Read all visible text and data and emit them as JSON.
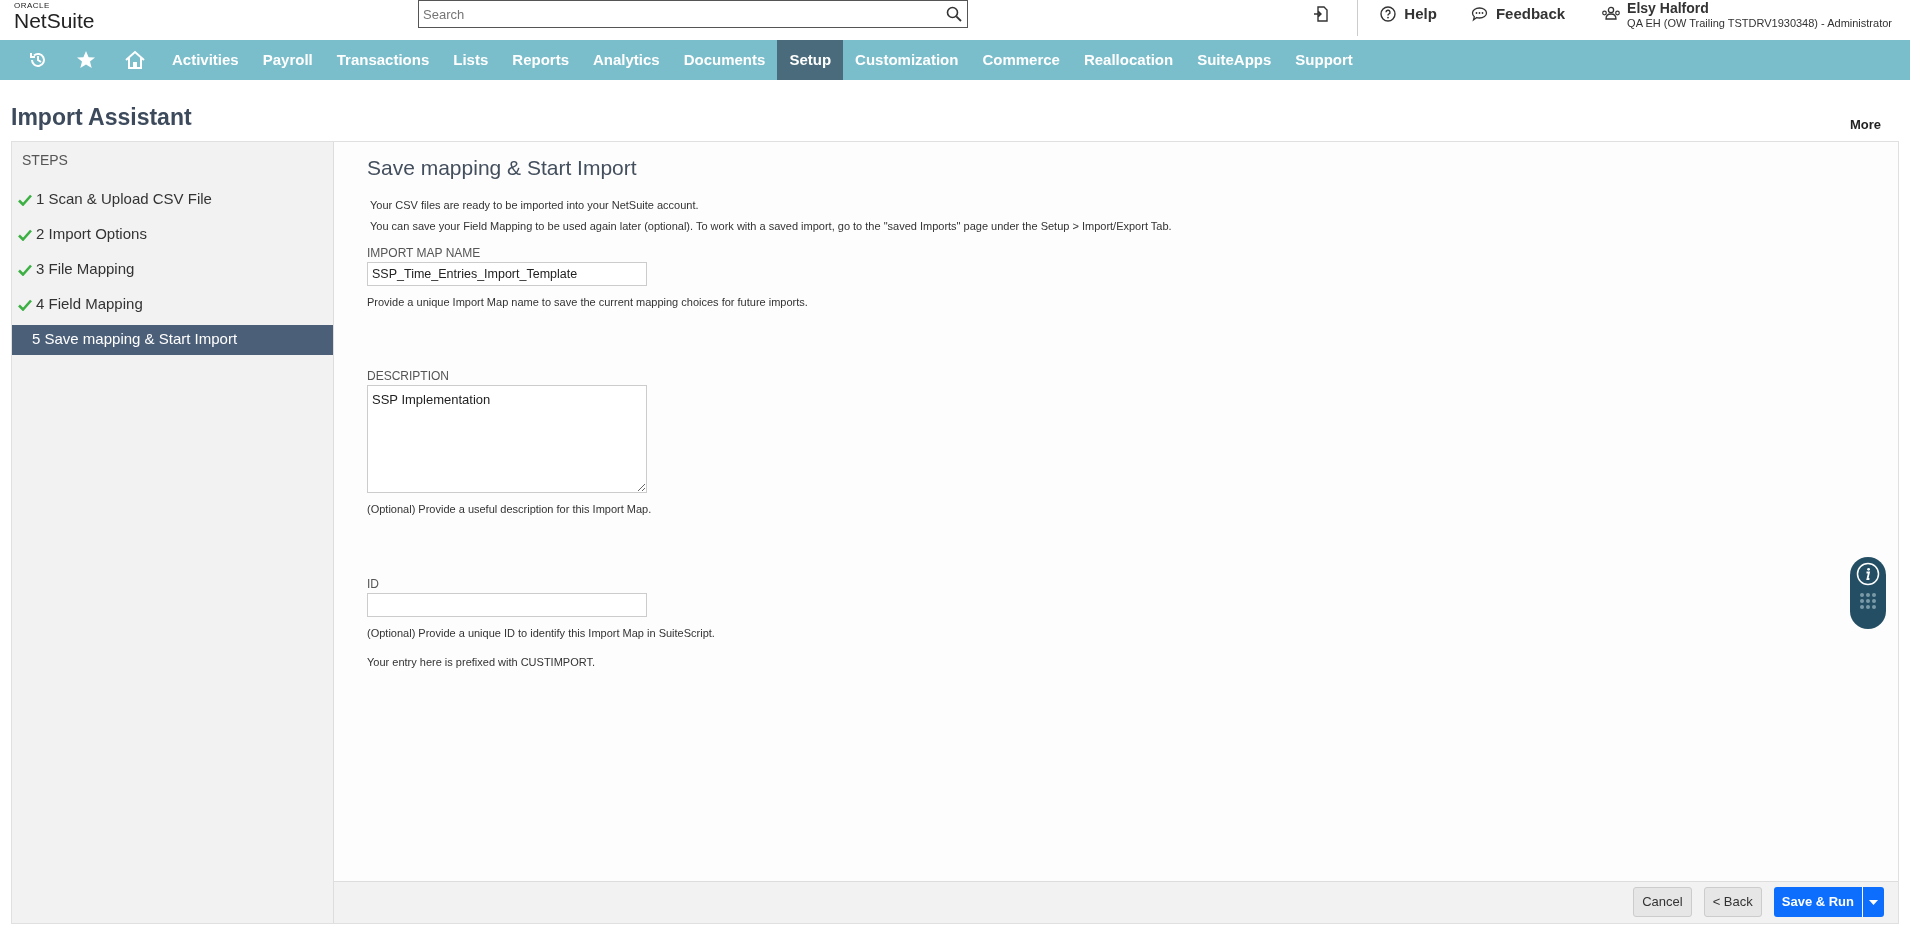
{
  "header": {
    "logo_top": "ORACLE",
    "logo": "NetSuite",
    "search": {
      "placeholder": "Search"
    },
    "help": "Help",
    "feedback": "Feedback",
    "user": {
      "name": "Elsy Halford",
      "role": "QA EH (OW Trailing TSTDRV1930348) - Administrator"
    }
  },
  "nav": {
    "items": [
      {
        "label": "Activities",
        "selected": false
      },
      {
        "label": "Payroll",
        "selected": false
      },
      {
        "label": "Transactions",
        "selected": false
      },
      {
        "label": "Lists",
        "selected": false
      },
      {
        "label": "Reports",
        "selected": false
      },
      {
        "label": "Analytics",
        "selected": false
      },
      {
        "label": "Documents",
        "selected": false
      },
      {
        "label": "Setup",
        "selected": true
      },
      {
        "label": "Customization",
        "selected": false
      },
      {
        "label": "Commerce",
        "selected": false
      },
      {
        "label": "Reallocation",
        "selected": false
      },
      {
        "label": "SuiteApps",
        "selected": false
      },
      {
        "label": "Support",
        "selected": false
      }
    ]
  },
  "page": {
    "title": "Import Assistant",
    "more": "More"
  },
  "steps": {
    "heading": "STEPS",
    "items": [
      {
        "label": "1 Scan & Upload CSV File",
        "done": true,
        "selected": false
      },
      {
        "label": "2 Import Options",
        "done": true,
        "selected": false
      },
      {
        "label": "3 File Mapping",
        "done": true,
        "selected": false
      },
      {
        "label": "4 Field Mapping",
        "done": true,
        "selected": false
      },
      {
        "label": "5 Save mapping & Start Import",
        "done": false,
        "selected": true
      }
    ]
  },
  "content": {
    "title": "Save mapping & Start Import",
    "intro": [
      "Your CSV files are ready to be imported into your NetSuite account.",
      "You can save your Field Mapping to be used again later (optional). To work with a saved import, go to the \"saved Imports\" page under the Setup > Import/Export Tab."
    ],
    "fields": [
      {
        "kind": "text",
        "label": "IMPORT MAP NAME",
        "value": "SSP_Time_Entries_Import_Template",
        "hints": [
          "Provide a unique Import Map name to save the current mapping choices for future imports."
        ]
      },
      {
        "kind": "textarea",
        "label": "DESCRIPTION",
        "value": "SSP Implementation",
        "hints": [
          "(Optional) Provide a useful description for this Import Map."
        ]
      },
      {
        "kind": "text",
        "label": "ID",
        "hints": [
          "(Optional) Provide a unique ID to identify this Import Map in SuiteScript.",
          "Your entry here is prefixed with CUSTIMPORT."
        ]
      }
    ]
  },
  "footer": {
    "buttons": [
      {
        "kind": "secondary",
        "label": "Cancel"
      },
      {
        "kind": "secondary",
        "label": "< Back"
      },
      {
        "kind": "primary",
        "label": "Save & Run"
      }
    ]
  }
}
